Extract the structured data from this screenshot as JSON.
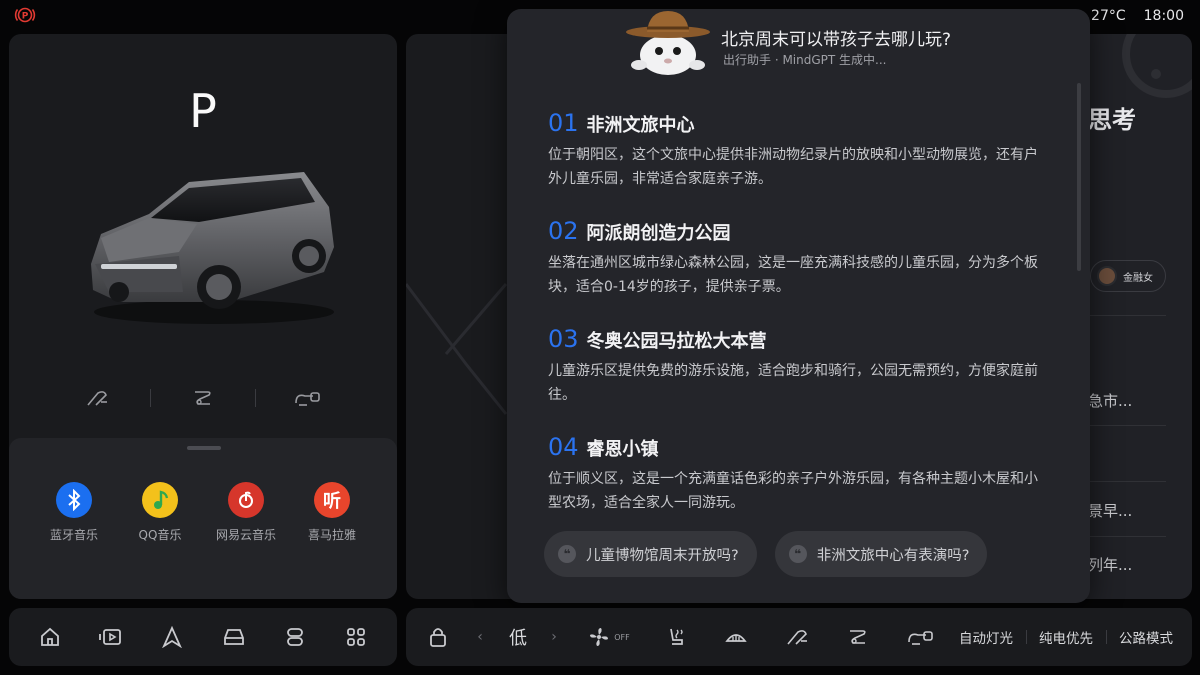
{
  "status_bar": {
    "temperature": "27°C",
    "time": "18:00"
  },
  "vehicle": {
    "gear": "P"
  },
  "media_apps": [
    {
      "label": "蓝牙音乐",
      "icon": "bluetooth-icon",
      "color": "#1b6ff0"
    },
    {
      "label": "QQ音乐",
      "icon": "qq-music-icon",
      "color": "#f3c11b"
    },
    {
      "label": "网易云音乐",
      "icon": "netease-music-icon",
      "color": "#d6362b"
    },
    {
      "label": "喜马拉雅",
      "icon": "ximalaya-icon",
      "color": "#e8452c"
    }
  ],
  "background_card": {
    "title": "思考",
    "chip_label": "金融女",
    "rows": [
      "急市...",
      "景早...",
      "列年..."
    ]
  },
  "assistant": {
    "question": "北京周末可以带孩子去哪儿玩?",
    "subtitle": "出行助手 · MindGPT 生成中...",
    "items": [
      {
        "num": "01",
        "title": "非洲文旅中心",
        "desc": "位于朝阳区，这个文旅中心提供非洲动物纪录片的放映和小型动物展览，还有户外儿童乐园，非常适合家庭亲子游。"
      },
      {
        "num": "02",
        "title": "阿派朗创造力公园",
        "desc": "坐落在通州区城市绿心森林公园，这是一座充满科技感的儿童乐园，分为多个板块，适合0-14岁的孩子，提供亲子票。"
      },
      {
        "num": "03",
        "title": "冬奥公园马拉松大本营",
        "desc": "儿童游乐区提供免费的游乐设施，适合跑步和骑行，公园无需预约，方便家庭前往。"
      },
      {
        "num": "04",
        "title": "睿恩小镇",
        "desc": "位于顺义区，这是一个充满童话色彩的亲子户外游乐园，有各种主题小木屋和小型农场，适合全家人一同游玩。"
      }
    ],
    "suggestions": [
      "儿童博物馆周末开放吗?",
      "非洲文旅中心有表演吗?"
    ]
  },
  "dock": {
    "left_icons": [
      "home-icon",
      "media-icon",
      "navigation-icon",
      "car-icon",
      "controls-icon",
      "apps-grid-icon"
    ]
  },
  "climate_bar": {
    "fan_level": "低",
    "fan_state": "OFF",
    "auto_lights": "自动灯光",
    "ev_priority": "纯电优先",
    "road_mode": "公路模式"
  }
}
